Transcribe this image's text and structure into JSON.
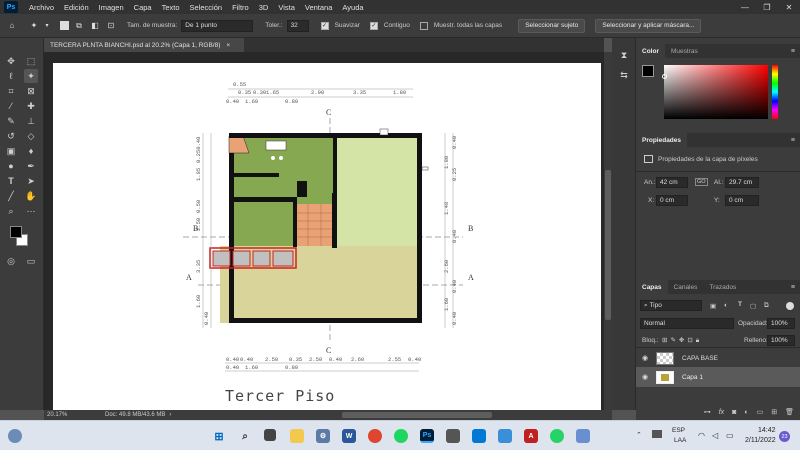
{
  "menubar": {
    "logo": "Ps",
    "items": [
      "Archivo",
      "Edición",
      "Imagen",
      "Capa",
      "Texto",
      "Selección",
      "Filtro",
      "3D",
      "Vista",
      "Ventana",
      "Ayuda"
    ],
    "minimize": "—",
    "maximize": "❐",
    "close": "✕"
  },
  "options": {
    "sample_size_label": "Tam. de muestra:",
    "sample_size_value": "De 1 punto",
    "tolerance_label": "Toler.:",
    "tolerance_value": "32",
    "antialias_label": "Suavizar",
    "contiguous_label": "Contiguo",
    "sample_all_label": "Muestr. todas las capas",
    "select_subject": "Seleccionar sujeto",
    "select_mask": "Seleccionar y aplicar máscara..."
  },
  "document": {
    "tab_title": "TERCERA PLNTA BIANCHI.psd al 20.2% (Capa 1, RGB/8)",
    "tab_close": "×",
    "zoom": "20.17%",
    "doc_info": "Doc: 49.8 MB/43.6 MB"
  },
  "plan": {
    "caption": "Tercer Piso",
    "section_labels": [
      "A",
      "A",
      "B",
      "B",
      "C",
      "C"
    ],
    "top_dims_row1": [
      "0.55"
    ],
    "top_dims_row2": [
      "0.35",
      "0.30",
      "1.65",
      "2.90",
      "3.35",
      "1.80"
    ],
    "top_dims_row3": [
      "0.40",
      "1.60",
      "0.80"
    ],
    "bottom_dims_row1": [
      "0.40",
      "0.40",
      "2.50",
      "0.35",
      "2.50",
      "0.40",
      "2.60",
      "2.55",
      "0.40"
    ],
    "bottom_dims_row2": [
      "0.40",
      "1.60",
      "0.80"
    ],
    "left_dims": [
      "0.250.40",
      "0.25 1.50",
      "1.85",
      "0.50",
      "2.50",
      "0.40",
      "3.35",
      "1.60",
      "0.40"
    ],
    "right_dims": [
      "0.40",
      "1.80",
      "0.25",
      "1.48",
      "0.40",
      "2.60",
      "0.40",
      "1.60",
      "0.40"
    ]
  },
  "color_panel": {
    "tabs": [
      "Color",
      "Muestras"
    ]
  },
  "properties_panel": {
    "title": "Propiedades",
    "subtitle": "Propiedades de la capa de píxeles",
    "width_label": "An.:",
    "width_value": "42 cm",
    "height_label": "Al.:",
    "height_value": "29.7 cm",
    "x_label": "X:",
    "x_value": "0 cm",
    "y_label": "Y:",
    "y_value": "0 cm",
    "link_icon": "GO"
  },
  "layers_panel": {
    "tabs": [
      "Capas",
      "Canales",
      "Trazados"
    ],
    "filter_value": "Tipo",
    "blend_mode": "Normal",
    "opacity_label": "Opacidad:",
    "opacity_value": "100%",
    "lock_label": "Bloq.:",
    "fill_label": "Relleno:",
    "fill_value": "100%",
    "layers": [
      {
        "name": "CAPA BASE"
      },
      {
        "name": "Capa 1"
      }
    ]
  },
  "taskbar": {
    "lang_top": "ESP",
    "lang_bottom": "LAA",
    "time": "14:42",
    "date": "2/11/2022",
    "notifications": "23"
  },
  "colors": {
    "accent": "#31a8ff",
    "wall": "#111111",
    "green_room": "#86a851",
    "light_green_room": "#d4e4a6",
    "khaki_room": "#d8d49a",
    "stair_orange": "#e8a276",
    "dashed_box": "#c0c0c0",
    "highlight_red": "#cc2222"
  }
}
